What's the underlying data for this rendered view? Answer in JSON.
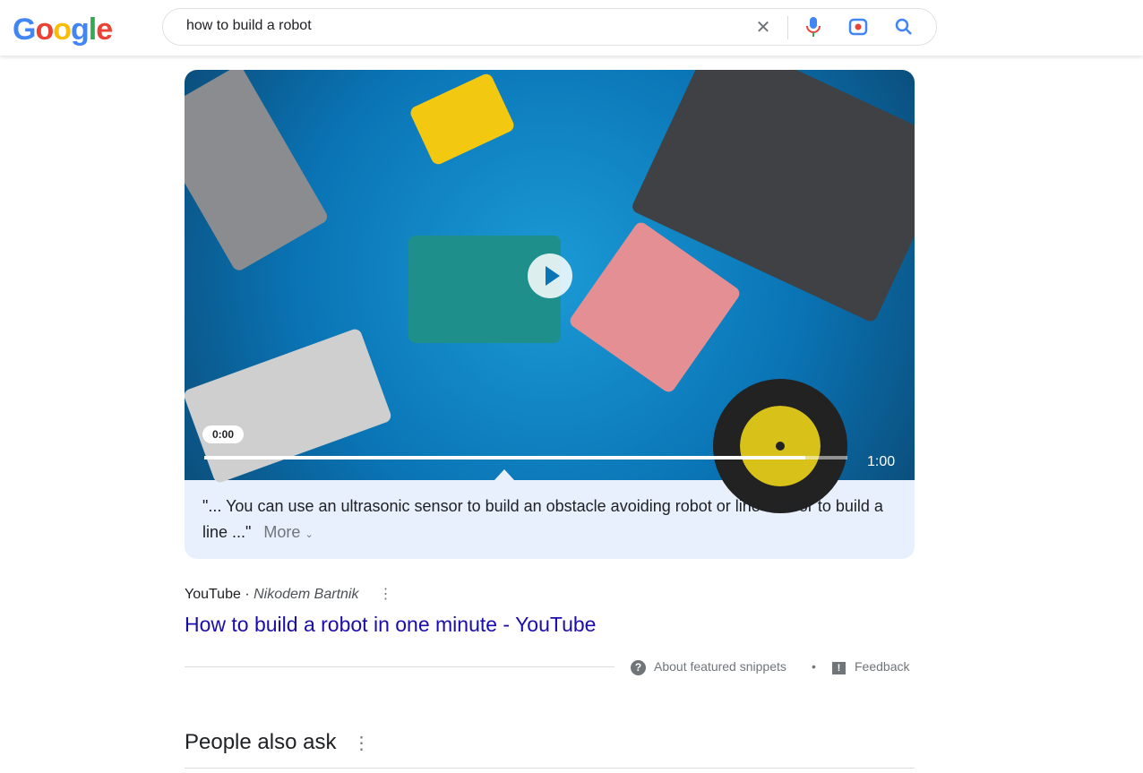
{
  "header": {
    "logo": "Google",
    "query": "how to build a robot"
  },
  "video": {
    "current_time": "0:00",
    "duration": "1:00",
    "progress": 0.935
  },
  "snippet": {
    "quote": "\"... You can use an ultrasonic sensor to build an obstacle avoiding robot or line sensor to build a line ...\"",
    "more_label": "More"
  },
  "result": {
    "source": "YouTube",
    "author": "Nikodem Bartnik",
    "title": "How to build a robot in one minute - YouTube"
  },
  "footer": {
    "about": "About featured snippets",
    "feedback": "Feedback"
  },
  "paa": {
    "title": "People also ask"
  }
}
